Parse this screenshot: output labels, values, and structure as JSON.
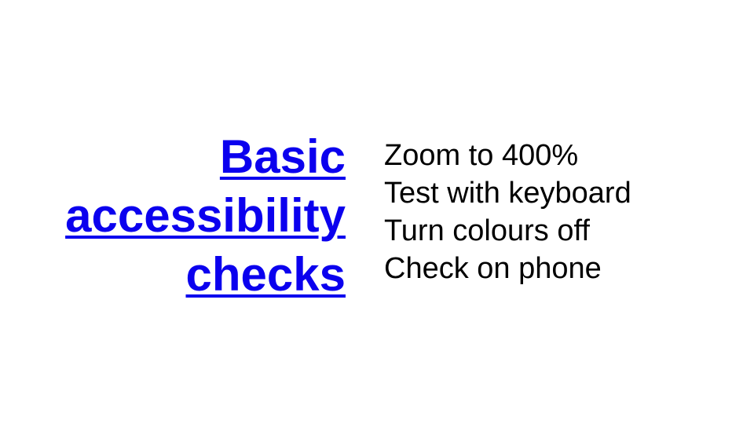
{
  "slide": {
    "title_lines": [
      "Basic",
      "accessibility",
      "checks"
    ],
    "checks": [
      "Zoom to 400%",
      "Test with keyboard",
      "Turn colours off",
      "Check on phone"
    ]
  },
  "colors": {
    "link": "#0b00ee",
    "text": "#000000",
    "background": "#ffffff"
  }
}
